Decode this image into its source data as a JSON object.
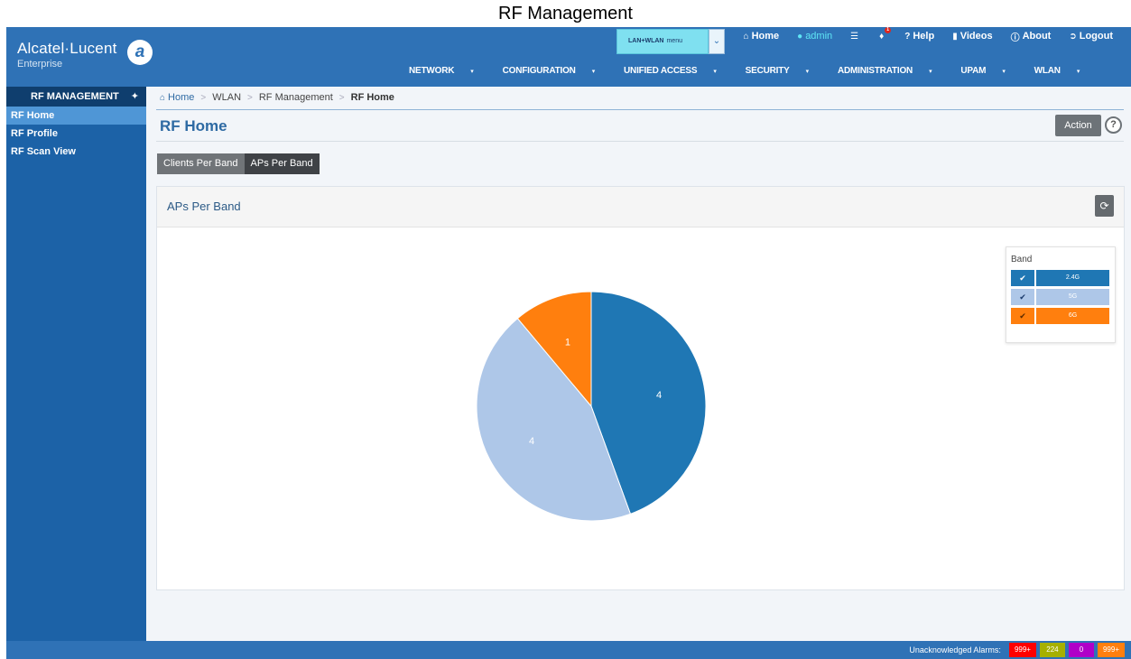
{
  "window_title": "RF Management",
  "brand": {
    "name": "Alcatel·Lucent",
    "sub": "Enterprise"
  },
  "menu_selector": {
    "value": "LAN+WLAN",
    "suffix": "menu"
  },
  "top_links": [
    {
      "label": "Home",
      "icon": "home-icon"
    },
    {
      "label": "admin",
      "icon": "user-icon"
    },
    {
      "label": "",
      "icon": "list-icon"
    },
    {
      "label": "",
      "icon": "bell-icon",
      "badge": "1"
    },
    {
      "label": "Help",
      "icon": "question-icon"
    },
    {
      "label": "Videos",
      "icon": "video-icon"
    },
    {
      "label": "About",
      "icon": "info-icon"
    },
    {
      "label": "Logout",
      "icon": "logout-icon"
    }
  ],
  "main_nav": [
    "NETWORK",
    "CONFIGURATION",
    "UNIFIED ACCESS",
    "SECURITY",
    "ADMINISTRATION",
    "UPAM",
    "WLAN"
  ],
  "sidebar": {
    "title": "RF MANAGEMENT",
    "items": [
      {
        "label": "RF Home",
        "active": true
      },
      {
        "label": "RF Profile",
        "active": false
      },
      {
        "label": "RF Scan View",
        "active": false
      }
    ]
  },
  "breadcrumb": [
    "Home",
    "WLAN",
    "RF Management",
    "RF Home"
  ],
  "page": {
    "title": "RF Home",
    "action_label": "Action",
    "help_label": "?"
  },
  "tabs": [
    {
      "label": "Clients Per Band",
      "active": false
    },
    {
      "label": "APs Per Band",
      "active": true
    }
  ],
  "panel": {
    "title": "APs Per Band"
  },
  "chart_data": {
    "type": "pie",
    "title": "",
    "legend_title": "Band",
    "legend_position": "top-right",
    "slices": [
      {
        "label": "2.4G",
        "value": 4,
        "color": "#1f77b4"
      },
      {
        "label": "5G",
        "value": 4,
        "color": "#aec7e8"
      },
      {
        "label": "6G",
        "value": 1,
        "color": "#ff7f0e"
      }
    ]
  },
  "footer": {
    "label": "Unacknowledged Alarms:",
    "alarms": [
      {
        "value": "999+",
        "color": "#ff0000"
      },
      {
        "value": "224",
        "color": "#a6b000"
      },
      {
        "value": "0",
        "color": "#b000c8"
      },
      {
        "value": "999+",
        "color": "#ff7f0e"
      }
    ]
  }
}
